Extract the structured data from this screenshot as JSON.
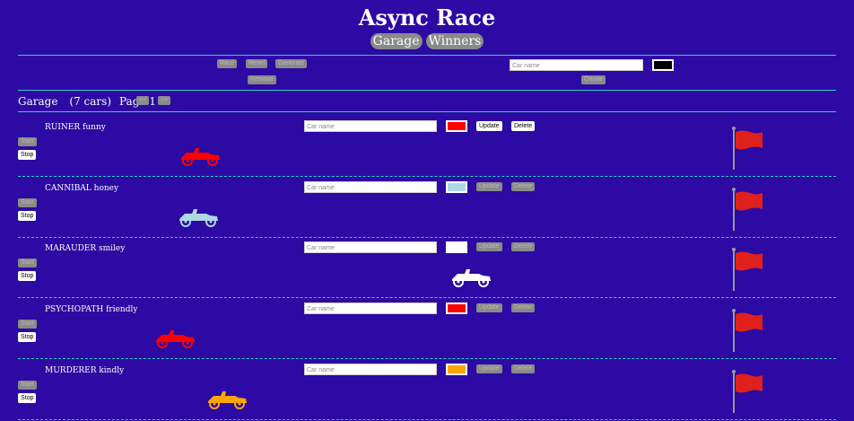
{
  "app": {
    "title": "Async Race"
  },
  "nav": {
    "garage": "Garage",
    "winners": "Winners"
  },
  "controls": {
    "race": "Race",
    "reset": "Reset",
    "generate": "Generate",
    "remove": "Remove",
    "create": "Create",
    "create_placeholder": "Car name",
    "create_color": "#000000"
  },
  "garage": {
    "label": "Garage",
    "count": "(7 cars)",
    "page": "Page 1",
    "prev": "<<",
    "next": ">>"
  },
  "cars": [
    {
      "name": "RUINER funny",
      "color": "#ff0000",
      "placeholder": "Car name",
      "start": "Start",
      "stop": "Stop",
      "update": "Update",
      "delete": "Delete",
      "update_enabled": true
    },
    {
      "name": "CANNIBAL honey",
      "color": "#add8e6",
      "placeholder": "Car name",
      "start": "Start",
      "stop": "Stop",
      "update": "Update",
      "delete": "Delete",
      "update_enabled": false
    },
    {
      "name": "MARAUDER smiley",
      "color": "#ffffff",
      "placeholder": "Car name",
      "start": "Start",
      "stop": "Stop",
      "update": "Update",
      "delete": "Delete",
      "update_enabled": false
    },
    {
      "name": "PSYCHOPATH friendly",
      "color": "#ff0000",
      "placeholder": "Car name",
      "start": "Start",
      "stop": "Stop",
      "update": "Update",
      "delete": "Delete",
      "update_enabled": false
    },
    {
      "name": "MURDERER kindly",
      "color": "#ffa500",
      "placeholder": "Car name",
      "start": "Start",
      "stop": "Stop",
      "update": "Update",
      "delete": "Delete",
      "update_enabled": false
    }
  ],
  "colors": {
    "background": "#2c0aa3",
    "divider": "#2ad4c3",
    "flag": "#e0201c"
  }
}
